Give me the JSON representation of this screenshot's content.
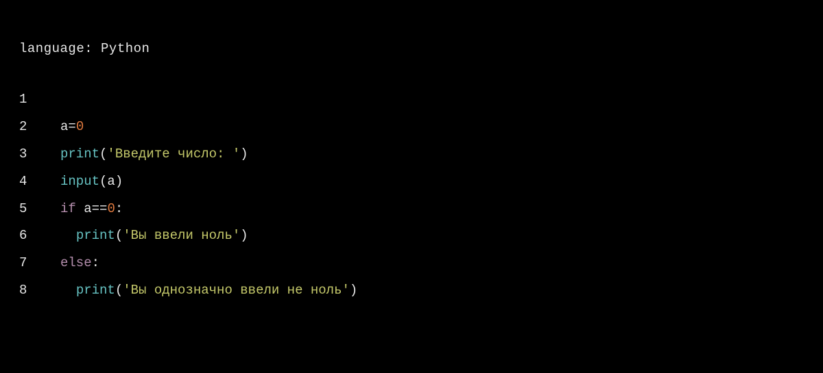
{
  "header": {
    "language_label": "language: Python"
  },
  "code": {
    "lines": [
      {
        "lineno": "1",
        "tokens": []
      },
      {
        "lineno": "2",
        "tokens": [
          {
            "cls": "tok-ident",
            "text": "a"
          },
          {
            "cls": "tok-op",
            "text": "="
          },
          {
            "cls": "tok-num",
            "text": "0"
          }
        ]
      },
      {
        "lineno": "3",
        "tokens": [
          {
            "cls": "tok-builtin",
            "text": "print"
          },
          {
            "cls": "tok-paren",
            "text": "("
          },
          {
            "cls": "tok-str",
            "text": "'Введите число: '"
          },
          {
            "cls": "tok-paren",
            "text": ")"
          }
        ]
      },
      {
        "lineno": "4",
        "tokens": [
          {
            "cls": "tok-builtin",
            "text": "input"
          },
          {
            "cls": "tok-paren",
            "text": "("
          },
          {
            "cls": "tok-ident",
            "text": "a"
          },
          {
            "cls": "tok-paren",
            "text": ")"
          }
        ]
      },
      {
        "lineno": "5",
        "tokens": [
          {
            "cls": "tok-kw",
            "text": "if"
          },
          {
            "cls": "tok-ident",
            "text": " a"
          },
          {
            "cls": "tok-op",
            "text": "=="
          },
          {
            "cls": "tok-num",
            "text": "0"
          },
          {
            "cls": "tok-colon",
            "text": ":"
          }
        ]
      },
      {
        "lineno": "6",
        "tokens": [
          {
            "cls": "tok-ident",
            "text": "  "
          },
          {
            "cls": "tok-builtin",
            "text": "print"
          },
          {
            "cls": "tok-paren",
            "text": "("
          },
          {
            "cls": "tok-str",
            "text": "'Вы ввели ноль'"
          },
          {
            "cls": "tok-paren",
            "text": ")"
          }
        ]
      },
      {
        "lineno": "7",
        "tokens": [
          {
            "cls": "tok-kw",
            "text": "else"
          },
          {
            "cls": "tok-colon",
            "text": ":"
          }
        ]
      },
      {
        "lineno": "8",
        "tokens": [
          {
            "cls": "tok-ident",
            "text": "  "
          },
          {
            "cls": "tok-builtin",
            "text": "print"
          },
          {
            "cls": "tok-paren",
            "text": "("
          },
          {
            "cls": "tok-str",
            "text": "'Вы однозначно ввели не ноль'"
          },
          {
            "cls": "tok-paren",
            "text": ")"
          }
        ]
      }
    ]
  }
}
